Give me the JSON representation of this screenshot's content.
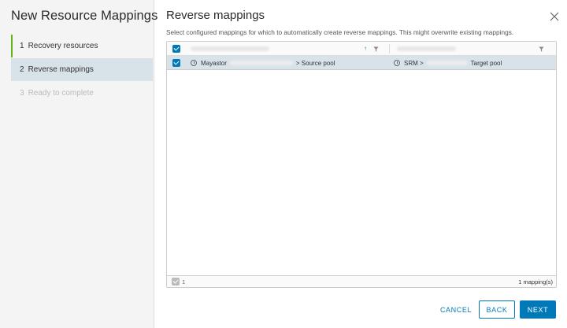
{
  "wizard": {
    "title": "New Resource Mappings",
    "steps": [
      {
        "num": "1",
        "label": "Recovery resources",
        "state": "done"
      },
      {
        "num": "2",
        "label": "Reverse mappings",
        "state": "active"
      },
      {
        "num": "3",
        "label": "Ready to complete",
        "state": "disabled"
      }
    ]
  },
  "page": {
    "title": "Reverse mappings",
    "subtitle": "Select configured mappings for which to automatically create reverse mappings. This might overwrite existing mappings."
  },
  "grid": {
    "row": {
      "source_prefix": "Mayastor",
      "source_suffix": "> Source pool",
      "target_prefix": "SRM >",
      "target_suffix": "Target pool"
    },
    "footer": {
      "selected_count": "1",
      "total": "1 mapping(s)"
    }
  },
  "buttons": {
    "cancel": "CANCEL",
    "back": "BACK",
    "next": "NEXT"
  },
  "colors": {
    "accent": "#0079b8",
    "complete": "#60b515",
    "selected_row": "#d8e3e9"
  }
}
